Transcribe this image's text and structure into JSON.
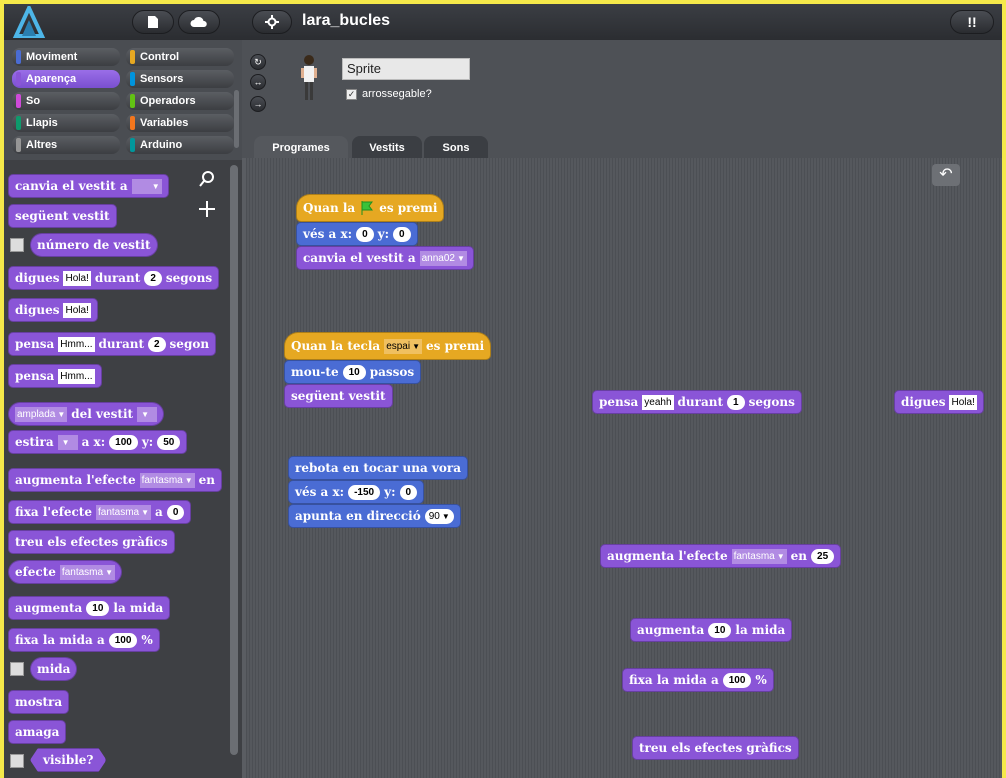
{
  "topbar": {
    "project_name": "lara_bucles"
  },
  "categories": [
    {
      "label": "Moviment",
      "color": "#4a6cd4"
    },
    {
      "label": "Control",
      "color": "#e6a822"
    },
    {
      "label": "Aparença",
      "color": "#8a55d7"
    },
    {
      "label": "Sensors",
      "color": "#0094dd"
    },
    {
      "label": "So",
      "color": "#cf4ad9"
    },
    {
      "label": "Operadors",
      "color": "#62c213"
    },
    {
      "label": "Llapis",
      "color": "#0e9a6c"
    },
    {
      "label": "Variables",
      "color": "#f3761d"
    },
    {
      "label": "Altres",
      "color": "#969696"
    },
    {
      "label": "Arduino",
      "color": "#00979c"
    }
  ],
  "palette": {
    "b1": "canvia el vestit a",
    "b2": "següent vestit",
    "b3": "número de vestit",
    "b4a": "digues",
    "b4v": "Hola!",
    "b4b": "durant",
    "b4n": "2",
    "b4c": "segons",
    "b5a": "digues",
    "b5v": "Hola!",
    "b6a": "pensa",
    "b6v": "Hmm...",
    "b6b": "durant",
    "b6n": "2",
    "b6c": "segon",
    "b7a": "pensa",
    "b7v": "Hmm...",
    "b8d": "amplada",
    "b8b": "del vestit",
    "b9a": "estira",
    "b9b": "a x:",
    "b9x": "100",
    "b9c": "y:",
    "b9y": "50",
    "b10a": "augmenta l'efecte",
    "b10d": "fantasma",
    "b10b": "en",
    "b11a": "fixa l'efecte",
    "b11d": "fantasma",
    "b11b": "a",
    "b11n": "0",
    "b12": "treu els efectes gràfics",
    "b13a": "efecte",
    "b13d": "fantasma",
    "b14a": "augmenta",
    "b14n": "10",
    "b14b": "la mida",
    "b15a": "fixa la mida a",
    "b15n": "100",
    "b15b": "%",
    "b16": "mida",
    "b17": "mostra",
    "b18": "amaga",
    "b19": "visible?"
  },
  "sprite": {
    "name": "Sprite",
    "draggable_label": "arrossegable?",
    "draggable_checked": "✓"
  },
  "tabs": [
    "Programes",
    "Vestits",
    "Sons"
  ],
  "script": {
    "h1a": "Quan la",
    "h1b": "es premi",
    "s1a": "vés a x:",
    "s1x": "0",
    "s1b": "y:",
    "s1y": "0",
    "s2a": "canvia el vestit a",
    "s2d": "anna02",
    "h2a": "Quan la tecla",
    "h2d": "espai",
    "h2b": "es premi",
    "s3a": "mou-te",
    "s3n": "10",
    "s3b": "passos",
    "s4": "següent vestit",
    "s5": "rebota en tocar una vora",
    "s6a": "vés a x:",
    "s6x": "-150",
    "s6b": "y:",
    "s6y": "0",
    "s7a": "apunta en direcció",
    "s7d": "90",
    "f1a": "pensa",
    "f1v": "yeahh",
    "f1b": "durant",
    "f1n": "1",
    "f1c": "segons",
    "f2a": "digues",
    "f2v": "Hola!",
    "f3a": "augmenta l'efecte",
    "f3d": "fantasma",
    "f3b": "en",
    "f3n": "25",
    "f4a": "augmenta",
    "f4n": "10",
    "f4b": "la mida",
    "f5a": "fixa la mida a",
    "f5n": "100",
    "f5b": "%",
    "f6": "treu els efectes gràfics"
  }
}
